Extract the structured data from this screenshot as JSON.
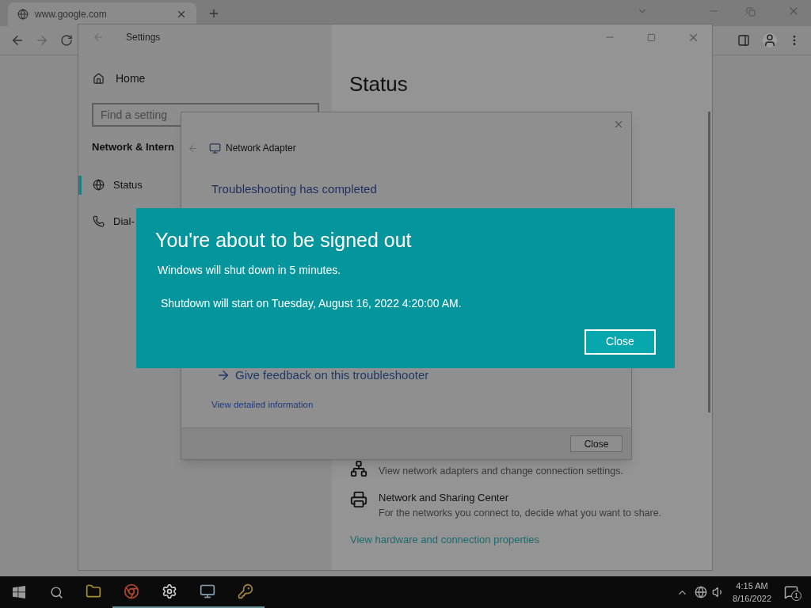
{
  "browser": {
    "tabs": [
      {
        "title": "www.google.com",
        "selected": true
      }
    ]
  },
  "settings": {
    "title": "Settings",
    "home": "Home",
    "search_placeholder": "Find a setting",
    "section": "Network & Intern",
    "items": [
      {
        "label": "Status",
        "selected": true
      },
      {
        "label": "Dial-",
        "selected": false
      }
    ],
    "heading": "Status",
    "options": [
      {
        "description": "View network adapters and change connection settings."
      },
      {
        "title": "Network and Sharing Center",
        "description": "For the networks you connect to, decide what you want to share."
      }
    ],
    "link": "View hardware and connection properties"
  },
  "troubleshooter": {
    "title": "Network Adapter",
    "heading": "Troubleshooting has completed",
    "feedback_link": "Give feedback on this troubleshooter",
    "details_link": "View detailed information",
    "button": "Close"
  },
  "notice": {
    "title": "You're about to be signed out",
    "message": "Windows will shut down in 5 minutes.",
    "detail": "Shutdown will start on Tuesday, August 16, 2022 4:20:00 AM.",
    "button": "Close"
  },
  "taskbar": {
    "apps": [
      {
        "running": false
      },
      {
        "running": true
      },
      {
        "running": true
      },
      {
        "running": true
      },
      {
        "running": true
      }
    ],
    "time": "4:15 AM",
    "date": "8/16/2022",
    "notifications": "1"
  }
}
